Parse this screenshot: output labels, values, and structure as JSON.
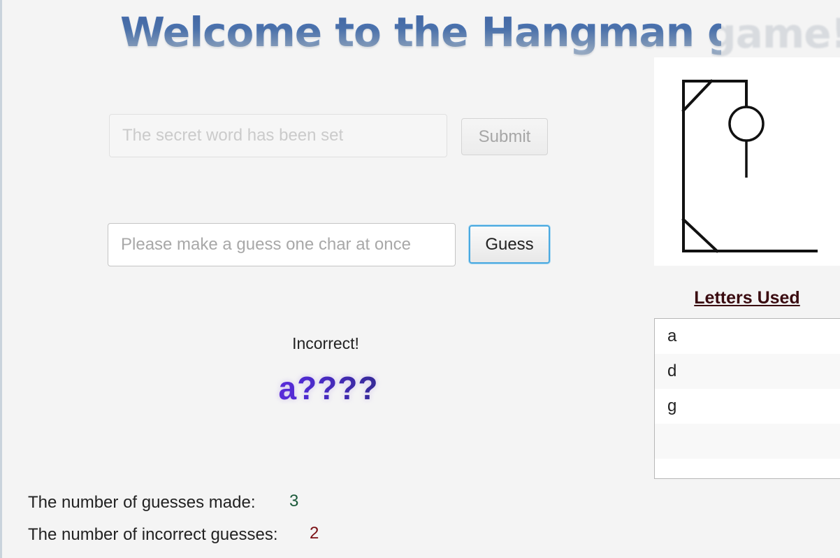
{
  "title": "Welcome to the Hangman game!",
  "secret_word": {
    "placeholder": "The secret word has been set",
    "submit_label": "Submit"
  },
  "guess": {
    "placeholder": "Please make a guess one char at once",
    "button_label": "Guess"
  },
  "status_text": "Incorrect!",
  "masked_word": "a????",
  "hangman": {
    "parts_drawn": [
      "gallows",
      "head",
      "body"
    ]
  },
  "letters_used": {
    "title": "Letters Used",
    "items": [
      "a",
      "d",
      "g",
      "",
      ""
    ]
  },
  "stats": {
    "guesses_made_label": "The number of guesses made:",
    "guesses_made_value": "3",
    "incorrect_label": "The number of incorrect guesses:",
    "incorrect_value": "2"
  },
  "colors": {
    "guesses_made_value": "#1b5a3a",
    "incorrect_value": "#7a0f14",
    "focus_ring": "#4aa9e0"
  }
}
